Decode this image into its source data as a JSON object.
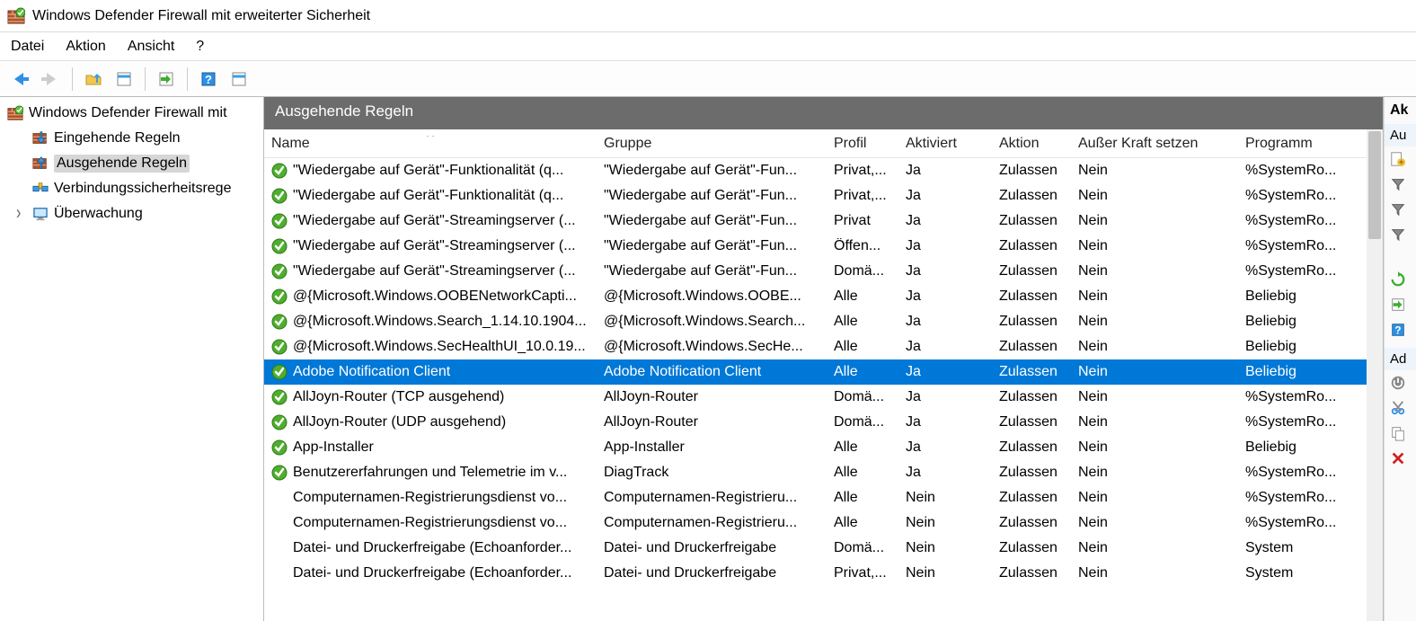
{
  "window": {
    "title": "Windows Defender Firewall mit erweiterter Sicherheit"
  },
  "menu": {
    "file": "Datei",
    "action": "Aktion",
    "view": "Ansicht",
    "help": "?"
  },
  "tree": {
    "root": "Windows Defender Firewall mit",
    "inbound": "Eingehende Regeln",
    "outbound": "Ausgehende Regeln",
    "connsec": "Verbindungssicherheitsrege",
    "monitor": "Überwachung"
  },
  "content": {
    "header": "Ausgehende Regeln"
  },
  "columns": {
    "name": "Name",
    "group": "Gruppe",
    "profile": "Profil",
    "enabled": "Aktiviert",
    "action": "Aktion",
    "override": "Außer Kraft setzen",
    "program": "Programm"
  },
  "actions": {
    "header": "Ak",
    "section": "Au"
  },
  "rows": [
    {
      "icon": "allow",
      "name": "\"Wiedergabe auf Gerät\"-Funktionalität (q...",
      "group": "\"Wiedergabe auf Gerät\"-Fun...",
      "profile": "Privat,...",
      "enabled": "Ja",
      "action": "Zulassen",
      "override": "Nein",
      "program": "%SystemRo..."
    },
    {
      "icon": "allow",
      "name": "\"Wiedergabe auf Gerät\"-Funktionalität (q...",
      "group": "\"Wiedergabe auf Gerät\"-Fun...",
      "profile": "Privat,...",
      "enabled": "Ja",
      "action": "Zulassen",
      "override": "Nein",
      "program": "%SystemRo..."
    },
    {
      "icon": "allow",
      "name": "\"Wiedergabe auf Gerät\"-Streamingserver (...",
      "group": "\"Wiedergabe auf Gerät\"-Fun...",
      "profile": "Privat",
      "enabled": "Ja",
      "action": "Zulassen",
      "override": "Nein",
      "program": "%SystemRo..."
    },
    {
      "icon": "allow",
      "name": "\"Wiedergabe auf Gerät\"-Streamingserver (...",
      "group": "\"Wiedergabe auf Gerät\"-Fun...",
      "profile": "Öffen...",
      "enabled": "Ja",
      "action": "Zulassen",
      "override": "Nein",
      "program": "%SystemRo..."
    },
    {
      "icon": "allow",
      "name": "\"Wiedergabe auf Gerät\"-Streamingserver (...",
      "group": "\"Wiedergabe auf Gerät\"-Fun...",
      "profile": "Domä...",
      "enabled": "Ja",
      "action": "Zulassen",
      "override": "Nein",
      "program": "%SystemRo..."
    },
    {
      "icon": "allow",
      "name": "@{Microsoft.Windows.OOBENetworkCapti...",
      "group": "@{Microsoft.Windows.OOBE...",
      "profile": "Alle",
      "enabled": "Ja",
      "action": "Zulassen",
      "override": "Nein",
      "program": "Beliebig"
    },
    {
      "icon": "allow",
      "name": "@{Microsoft.Windows.Search_1.14.10.1904...",
      "group": "@{Microsoft.Windows.Search...",
      "profile": "Alle",
      "enabled": "Ja",
      "action": "Zulassen",
      "override": "Nein",
      "program": "Beliebig"
    },
    {
      "icon": "allow",
      "name": "@{Microsoft.Windows.SecHealthUI_10.0.19...",
      "group": "@{Microsoft.Windows.SecHe...",
      "profile": "Alle",
      "enabled": "Ja",
      "action": "Zulassen",
      "override": "Nein",
      "program": "Beliebig"
    },
    {
      "icon": "allow",
      "name": "Adobe Notification Client",
      "group": "Adobe Notification Client",
      "profile": "Alle",
      "enabled": "Ja",
      "action": "Zulassen",
      "override": "Nein",
      "program": "Beliebig",
      "selected": true
    },
    {
      "icon": "allow",
      "name": "AllJoyn-Router (TCP ausgehend)",
      "group": "AllJoyn-Router",
      "profile": "Domä...",
      "enabled": "Ja",
      "action": "Zulassen",
      "override": "Nein",
      "program": "%SystemRo..."
    },
    {
      "icon": "allow",
      "name": "AllJoyn-Router (UDP ausgehend)",
      "group": "AllJoyn-Router",
      "profile": "Domä...",
      "enabled": "Ja",
      "action": "Zulassen",
      "override": "Nein",
      "program": "%SystemRo..."
    },
    {
      "icon": "allow",
      "name": "App-Installer",
      "group": "App-Installer",
      "profile": "Alle",
      "enabled": "Ja",
      "action": "Zulassen",
      "override": "Nein",
      "program": "Beliebig"
    },
    {
      "icon": "allow",
      "name": "Benutzererfahrungen und Telemetrie im v...",
      "group": "DiagTrack",
      "profile": "Alle",
      "enabled": "Ja",
      "action": "Zulassen",
      "override": "Nein",
      "program": "%SystemRo..."
    },
    {
      "icon": "none",
      "name": "Computernamen-Registrierungsdienst vo...",
      "group": "Computernamen-Registrieru...",
      "profile": "Alle",
      "enabled": "Nein",
      "action": "Zulassen",
      "override": "Nein",
      "program": "%SystemRo..."
    },
    {
      "icon": "none",
      "name": "Computernamen-Registrierungsdienst vo...",
      "group": "Computernamen-Registrieru...",
      "profile": "Alle",
      "enabled": "Nein",
      "action": "Zulassen",
      "override": "Nein",
      "program": "%SystemRo..."
    },
    {
      "icon": "none",
      "name": "Datei- und Druckerfreigabe (Echoanforder...",
      "group": "Datei- und Druckerfreigabe",
      "profile": "Domä...",
      "enabled": "Nein",
      "action": "Zulassen",
      "override": "Nein",
      "program": "System"
    },
    {
      "icon": "none",
      "name": "Datei- und Druckerfreigabe (Echoanforder...",
      "group": "Datei- und Druckerfreigabe",
      "profile": "Privat,...",
      "enabled": "Nein",
      "action": "Zulassen",
      "override": "Nein",
      "program": "System"
    }
  ]
}
